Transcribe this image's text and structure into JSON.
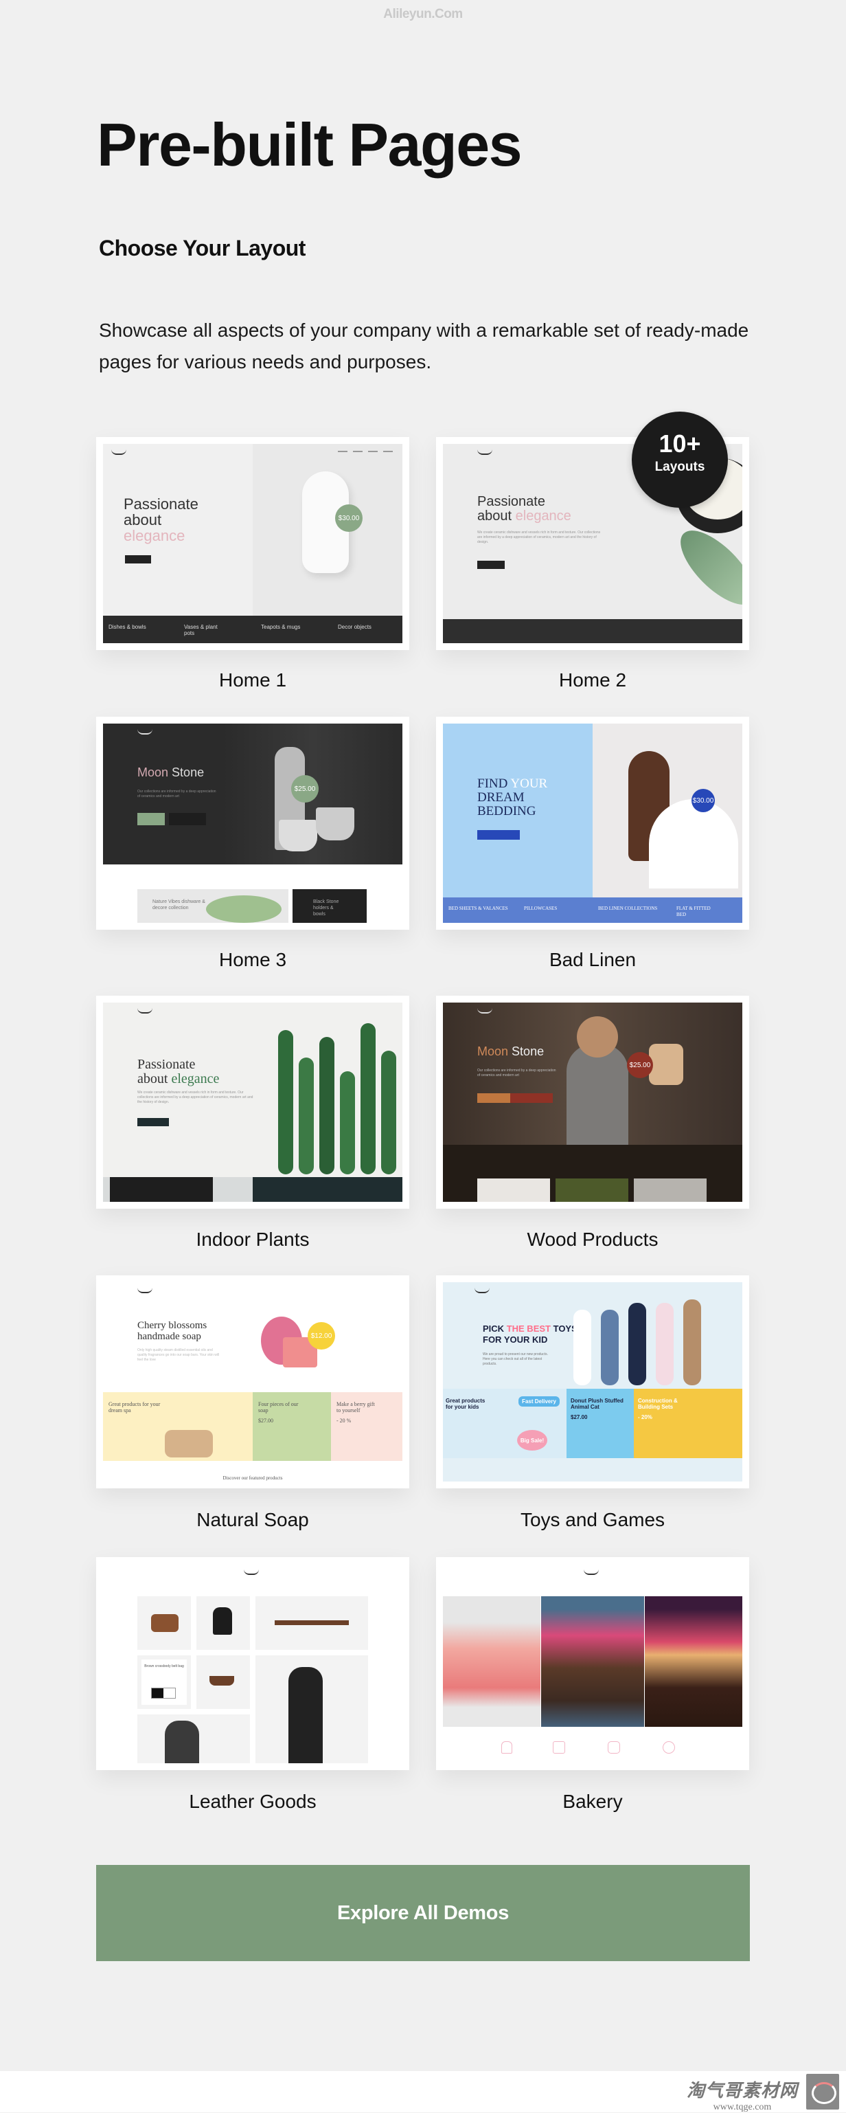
{
  "watermark": "Alileyun.Com",
  "title": "Pre-built Pages",
  "subtitle": "Choose Your Layout",
  "description": "Showcase all aspects of your company with a remarkable set of ready-made pages for various needs and purposes.",
  "badge": {
    "number": "10+",
    "label": "Layouts"
  },
  "cards": [
    {
      "label": "Home 1",
      "heading": [
        "Passionate",
        "about",
        "elegance"
      ],
      "price": "$30.00",
      "categories": [
        "Dishes & bowls",
        "Vases & plant pots",
        "Teapots & mugs",
        "Decor objects"
      ]
    },
    {
      "label": "Home 2",
      "heading": [
        "Passionate",
        "about",
        "elegance"
      ],
      "text": "We create ceramic dishware and vessels rich in form and texture. Our collections are informed by a deep appreciation of ceramics, modern art and the history of design."
    },
    {
      "label": "Home 3",
      "heading": [
        "Moon",
        "Stone"
      ],
      "text": "Our collections are informed by a deep appreciation of ceramics and modern art",
      "price": "$25.00",
      "tiles": [
        "Nature Vibes dishware & decore collection",
        "Black Stone holders & bowls"
      ]
    },
    {
      "label": "Bad Linen",
      "heading": [
        "FIND",
        "YOUR",
        "DREAM BEDDING"
      ],
      "price": "$30.00",
      "categories": [
        "BED SHEETS & VALANCES",
        "PILLOWCASES",
        "BED LINEN COLLECTIONS",
        "FLAT & FITTED BED"
      ]
    },
    {
      "label": "Indoor Plants",
      "heading": [
        "Passionate",
        "about",
        "elegance"
      ],
      "text": "We create ceramic dishware and vessels rich in form and texture. Our collections are informed by a deep appreciation of ceramics, modern art and the history of design."
    },
    {
      "label": "Wood Products",
      "heading": [
        "Moon",
        "Stone"
      ],
      "text": "Our collections are informed by a deep appreciation of ceramics and modern art",
      "price": "$25.00"
    },
    {
      "label": "Natural Soap",
      "heading": [
        "Cherry blossoms",
        "handmade soap"
      ],
      "text": "Only high quality steam distilled essential oils and quality fragrances go into our soap bars. Your skin will feel the love",
      "price": "$12.00",
      "tiles": [
        "Great products for your dream spa",
        "Four pieces of our soap",
        "Make a berry gift to yourself"
      ],
      "tile_values": [
        "$27.00",
        "- 20 %"
      ],
      "footer": "Discover our featured products"
    },
    {
      "label": "Toys and Games",
      "heading": [
        "PICK",
        "THE BEST",
        "TOYS",
        "FOR YOUR KID"
      ],
      "text": "We are proud to present our new products. Here you can check out all of the latest products.",
      "tiles": [
        "Great products for your kids",
        "Fast Delivery",
        "Big Sale!",
        "Donut Plush Stuffed Animal Cat",
        "Construction & Building Sets"
      ],
      "tile_values": [
        "$27.00",
        "- 20%"
      ]
    },
    {
      "label": "Leather Goods",
      "product": "Brown crossbody belt bag"
    },
    {
      "label": "Bakery"
    }
  ],
  "explore_button": "Explore All Demos",
  "footer_logo": {
    "name": "淘气哥素材网",
    "url": "www.tqge.com"
  },
  "colors": {
    "background": "#f0f0f0",
    "accent": "#7b9b7a",
    "badge": "#1b1b1b",
    "pink": "#e3b5bd"
  }
}
